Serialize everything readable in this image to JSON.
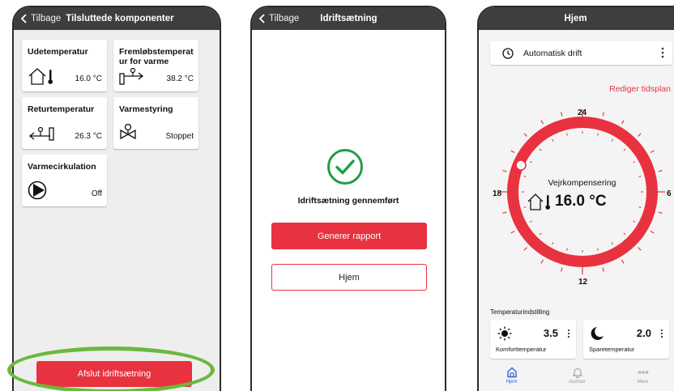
{
  "screen1": {
    "back_label": "Tilbage",
    "title": "Tilsluttede komponenter",
    "tiles": [
      {
        "title": "Udetemperatur",
        "value": "16.0 °C",
        "icon": "house-thermometer-icon"
      },
      {
        "title": "Fremløbstemperat ur for varme",
        "value": "38.2 °C",
        "icon": "flow-pipe-icon"
      },
      {
        "title": "Returtemperatur",
        "value": "26.3 °C",
        "icon": "return-pipe-icon"
      },
      {
        "title": "Varmestyring",
        "value": "Stoppet",
        "icon": "valve-icon"
      },
      {
        "title": "Varmecirkulation",
        "value": "Off",
        "icon": "pump-icon"
      }
    ],
    "finish_button": "Afslut idriftsætning",
    "colors": {
      "accent": "#e8323f",
      "highlight": "#6cb83f"
    }
  },
  "screen2": {
    "back_label": "Tilbage",
    "title": "Idriftsætning",
    "status_text": "Idriftsætning gennemført",
    "report_button": "Generer rapport",
    "home_button": "Hjem",
    "colors": {
      "check": "#1e9e45"
    }
  },
  "screen3": {
    "title": "Hjem",
    "mode": "Automatisk drift",
    "edit_schedule": "Rediger tidsplan",
    "dial_labels": {
      "top": "24",
      "right": "6",
      "bottom": "12",
      "left": "18"
    },
    "compensation_label": "Vejrkompensering",
    "outdoor_temp": "16.0 °C",
    "section_title": "Temperaturindstilling",
    "comfort": {
      "value": "3.5",
      "label": "Komforttemperatur"
    },
    "saving": {
      "value": "2.0",
      "label": "Sparetemperatur"
    },
    "tabs": [
      {
        "label": "Hjem",
        "icon": "home-icon",
        "active": true
      },
      {
        "label": "Alarmer",
        "icon": "bell-icon",
        "active": false
      },
      {
        "label": "Mere",
        "icon": "more-icon",
        "active": false
      }
    ],
    "colors": {
      "active_tab": "#3563d8"
    }
  }
}
